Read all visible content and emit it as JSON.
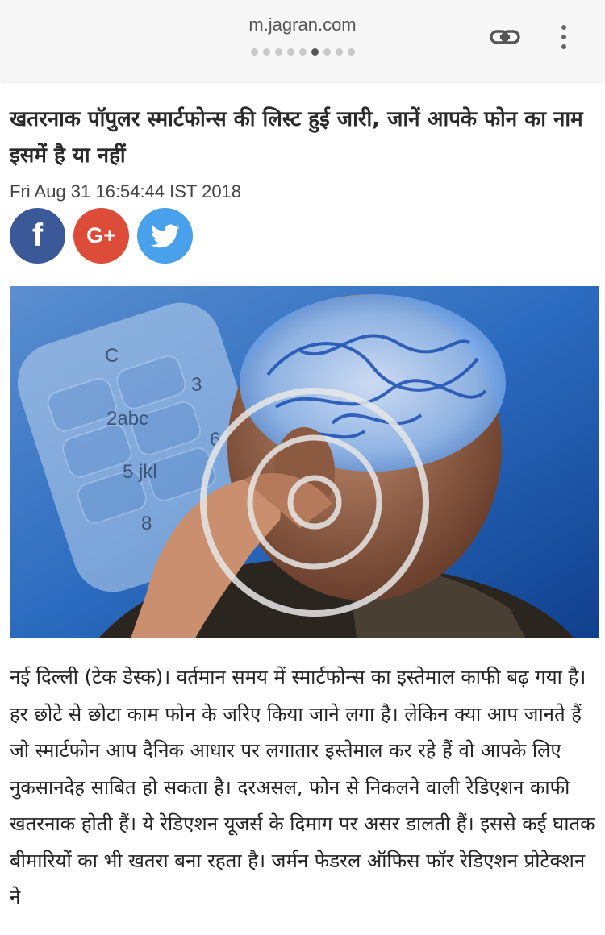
{
  "browser": {
    "url": "m.jagran.com",
    "tab_dots": 9,
    "active_tab_dot": 6
  },
  "article": {
    "headline": "खतरनाक पॉपुलर स्मार्टफोन्स की लिस्ट हुई जारी, जानें आपके फोन का नाम इसमें है या नहीं",
    "date": "Fri Aug 31 16:54:44 IST 2018",
    "share": {
      "facebook": "f",
      "google": "G+",
      "twitter_icon": "twitter-bird-icon"
    },
    "image": {
      "keypad_keys": [
        "C",
        "2abc",
        "3",
        "5 jkl",
        "6",
        "8"
      ]
    },
    "body": "नई दिल्ली (टेक डेस्क)। वर्तमान समय में स्मार्टफोन्स का इस्तेमाल काफी बढ़ गया है। हर छोटे से छोटा काम फोन के जरिए किया जाने लगा है। लेकिन क्या आप जानते हैं जो स्मार्टफोन आप दैनिक आधार पर लगातार इस्तेमाल कर रहे हैं वो आपके लिए नुकसानदेह साबित हो सकता है। दरअसल, फोन से निकलने वाली रेडिएशन काफी खतरनाक होती हैं। ये रेडिएशन यूजर्स के दिमाग पर असर डालती हैं। इससे कई घातक बीमारियों का भी खतरा बना रहता है। जर्मन फेडरल ऑफिस फॉर रेडिएशन प्रोटेक्शन ने"
  },
  "colors": {
    "facebook": "#3b5998",
    "google": "#dd4b39",
    "twitter": "#4aa1eb"
  }
}
